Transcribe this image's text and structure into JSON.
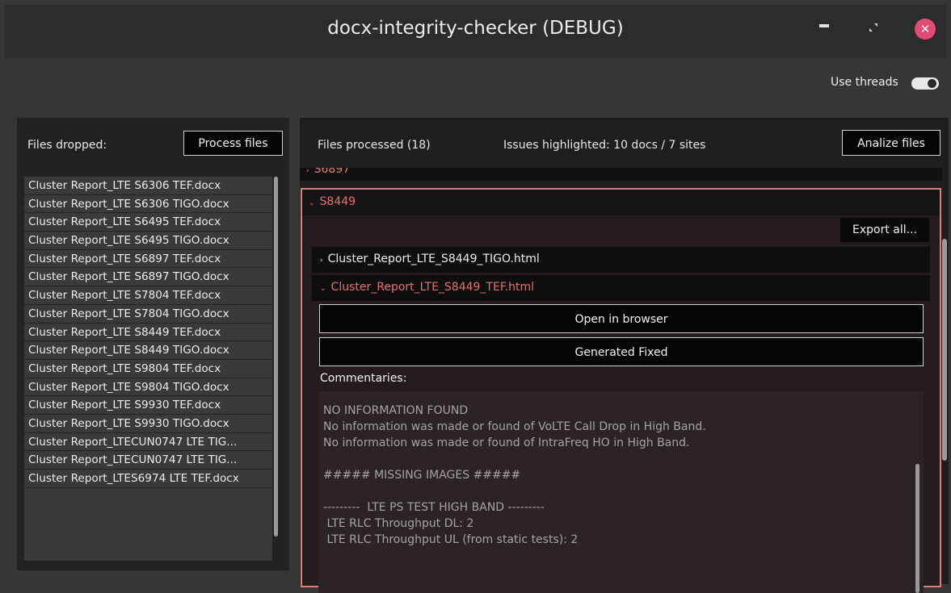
{
  "window": {
    "title": "docx-integrity-checker (DEBUG)",
    "minimize_icon": "minimize-icon",
    "maximize_icon": "maximize-icon",
    "close_icon": "close-icon",
    "close_symbol": "✕",
    "close_color": "#e24b73"
  },
  "toolbar": {
    "use_threads_label": "Use threads",
    "use_threads_on": true
  },
  "left_panel": {
    "label": "Files dropped:",
    "process_button": "Process files",
    "files": [
      "Cluster Report_LTE S6306 TEF.docx",
      "Cluster Report_LTE S6306 TIGO.docx",
      "Cluster Report_LTE S6495 TEF.docx",
      "Cluster Report_LTE S6495 TIGO.docx",
      "Cluster Report_LTE S6897 TEF.docx",
      "Cluster Report_LTE S6897 TIGO.docx",
      "Cluster Report_LTE S7804 TEF.docx",
      "Cluster Report_LTE S7804 TIGO.docx",
      "Cluster Report_LTE S8449 TEF.docx",
      "Cluster Report_LTE S8449 TIGO.docx",
      "Cluster Report_LTE S9804 TEF.docx",
      "Cluster Report_LTE S9804 TIGO.docx",
      "Cluster Report_LTE S9930 TEF.docx",
      "Cluster Report_LTE S9930 TIGO.docx",
      "Cluster Report_LTECUN0747 LTE TIG...",
      "Cluster Report_LTECUN0747 LTE TIG...",
      "Cluster Report_LTES6974 LTE TEF.docx"
    ]
  },
  "right_panel": {
    "files_processed": "Files processed (18)",
    "issues": "Issues highlighted: 10 docs / 7 sites",
    "analize_button": "Analize files",
    "prev_section_label": "S6897",
    "section": {
      "label": "S8449",
      "export_button": "Export all...",
      "files": [
        {
          "name": "Cluster_Report_LTE_S8449_TIGO.html",
          "expanded": false
        },
        {
          "name": "Cluster_Report_LTE_S8449_TEF.html",
          "expanded": true
        }
      ],
      "open_browser_button": "Open in browser",
      "generated_button": "Generated Fixed",
      "commentaries_label": "Commentaries:",
      "commentaries": "NO INFORMATION FOUND\nNo information was made or found of VoLTE Call Drop in High Band.\nNo information was made or found of IntraFreq HO in High Band.\n\n##### MISSING IMAGES #####\n\n---------  LTE PS TEST HIGH BAND ---------\n LTE RLC Throughput DL: 2\n LTE RLC Throughput UL (from static tests): 2"
    }
  },
  "colors": {
    "background": "#363636",
    "panel": "#222222",
    "accent_expanded": "#e86e6e",
    "section_border": "#dc7f7f"
  }
}
